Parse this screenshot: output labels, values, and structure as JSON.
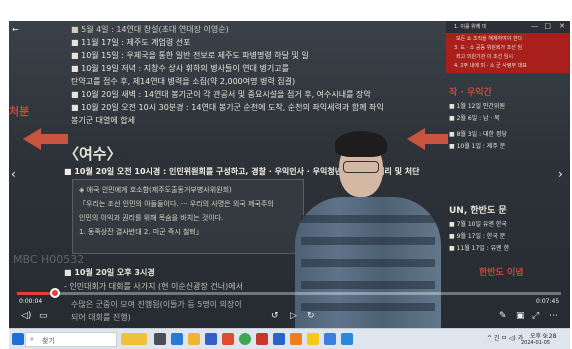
{
  "slide": {
    "lines_top": [
      "■ 5월 4일 : 14연대 창설(초대 연대장 이영순)",
      "■ 11월 17일 : 제주도 계엄령 선포",
      "■ 10월 15일 : 우제국을 통한 일반 전보로 제주도 파병명령 하달 및 일",
      "■ 10월 19일 저녁 : 지창수 상사 휘하의 병사들이 연대 병기고를",
      "  탄약고를 접수 후, 제14연대 병력을 소집(약 2,000여명 병력 집결)",
      "■ 10월 20일 새벽 : 14연대 봉기군이 각 관공서 및 중요시설을 점거 후, 여수시내를 장악",
      "■ 10월 20일 오전 10시 30분경 : 14연대 봉기군 순천에 도착, 순천의 좌익세력과 함께 좌익",
      "  봉기군 대열에 합세"
    ],
    "left_label": "처분",
    "section_title": "〈여수〉",
    "main_line": "■ 10월 20일 오전 10시경 : 인민위원회를 구성하고, 경찰 · 우익인사 · 우익청년단원 대한 처리 및 처단",
    "quote_lines": [
      "◈ 애국 인민에게 호소함(제주도출동거부병사위원회)",
      "「우리는 조선 인민의 아들들이다. ··· 우리의 사명은 외국 제국주의",
      "인민의 이익과 권리를 위해 목숨을 바치는 것이다.",
      "1. 동족상잔 결사반대 2. 미군 즉시 철퇴」"
    ],
    "bottom_line1": "■ 10월 20일 오후 3시경",
    "bottom_line2": "- 인민대회가 대회를 사가지 (현 이순신광장 건너)에서",
    "bottom_line3": "수많은 군중이 모여 진행됨(이들가 등 5명이 의장이",
    "bottom_line4": "되어 대회를 진행)",
    "right_head": "작 · 우익간",
    "right_items": [
      "■ 1월 12일 인간위원",
      "■ 2월 6일 : 남 · 북",
      "■ 8월 3일 : 대한 정당",
      "■ 10월 1일 : 제주 분"
    ],
    "right_mid": "UN, 한반도 문",
    "right_items2": [
      "■ 7월 10일 유엔 한국",
      "■ 9월 17일 : 한국 문",
      "■ 11월 17일 : 유엔 한"
    ],
    "right_bottom": "한반도 이념",
    "watermark": "MBC H00532"
  },
  "popup": {
    "line1": "1. 이를 위해 미",
    "line2": "모든 쇼 조직을 해체하여야 한다",
    "line3": "3. 도 · 소 공동 위원회가 조선 임",
    "line4": "최고 의원기관 이 조선 임시",
    "line5": "4. 2주 내에 미 · 소 군 사령부 대표",
    "controls": [
      "—",
      "□",
      "✕"
    ]
  },
  "player": {
    "current_time": "0:00:04",
    "total_time": "0:07:45",
    "progress": 0.01,
    "accent": "#e83b3b"
  },
  "taskbar": {
    "search_placeholder": "찾기",
    "time": "오후 9:28",
    "date": "2024-01-05",
    "tray_text": "^ 긴 ㅁ ◁) 가"
  }
}
